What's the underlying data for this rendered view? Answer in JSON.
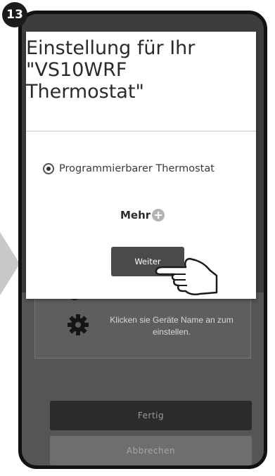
{
  "step_badge": "13",
  "dialog": {
    "title_lines": [
      "Einstellung für Ihr",
      "\"VS10WRF",
      "Thermostat\""
    ],
    "radio_option": "Programmierbarer Thermostat",
    "more_label": "Mehr",
    "more_icon": "plus-circle-icon",
    "next_button": "Weiter"
  },
  "background": {
    "hint_text": "Klicken sie Geräte Name an zum einstellen.",
    "hint_icon": "gear-icon",
    "done_button": "Fertig",
    "cancel_button": "Abbrechen"
  },
  "colors": {
    "dialog_bg": "#ffffff",
    "primary_button": "#4a4a4a",
    "overlay_dark": "#3d3d3d"
  }
}
